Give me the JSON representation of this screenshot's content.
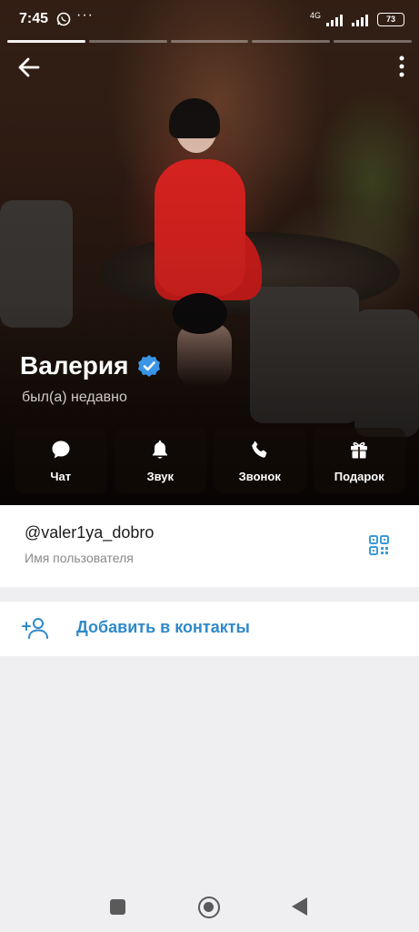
{
  "status_bar": {
    "time": "7:45",
    "more_indicator": "···",
    "network_label": "4G",
    "battery": "73"
  },
  "profile": {
    "name": "Валерия",
    "last_seen": "был(а) недавно",
    "verified": true
  },
  "actions": [
    {
      "label": "Чат",
      "icon": "chat-icon"
    },
    {
      "label": "Звук",
      "icon": "bell-icon"
    },
    {
      "label": "Звонок",
      "icon": "phone-icon"
    },
    {
      "label": "Подарок",
      "icon": "gift-icon"
    }
  ],
  "info": {
    "username": "@valer1ya_dobro",
    "username_label": "Имя пользователя"
  },
  "add_contact": {
    "label": "Добавить в контакты"
  },
  "colors": {
    "accent": "#2f89c9",
    "verified": "#3a95e6",
    "background": "#efeff1"
  }
}
